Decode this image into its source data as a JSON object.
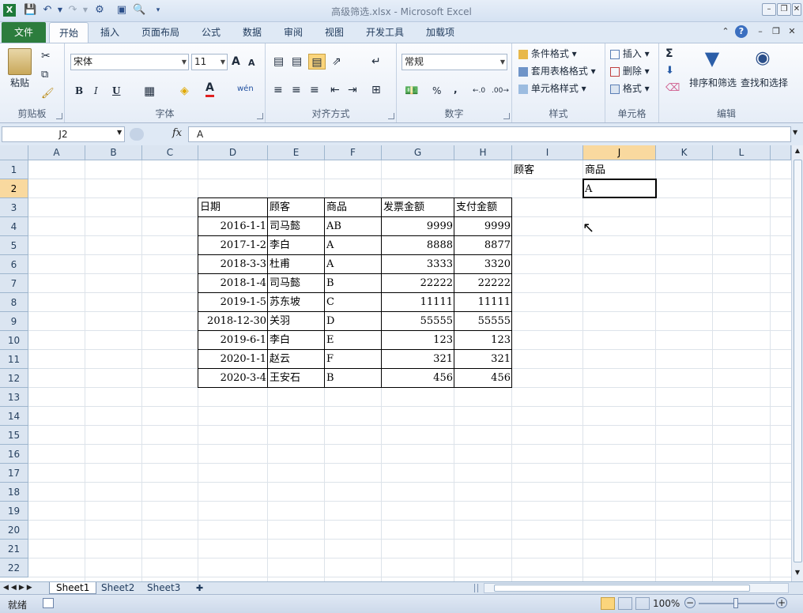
{
  "window": {
    "title": "高级筛选.xlsx - Microsoft Excel"
  },
  "ribbon_tabs": [
    "文件",
    "开始",
    "插入",
    "页面布局",
    "公式",
    "数据",
    "审阅",
    "视图",
    "开发工具",
    "加载项"
  ],
  "ribbon": {
    "clipboard": {
      "paste": "粘贴",
      "group": "剪贴板"
    },
    "font": {
      "name": "宋体",
      "size": "11",
      "bold": "B",
      "italic": "I",
      "underline": "U",
      "grow": "A",
      "shrink": "A",
      "color_a": "A",
      "wen": "wén",
      "group": "字体"
    },
    "alignment": {
      "group": "对齐方式"
    },
    "number": {
      "format": "常规",
      "percent": "%",
      "comma": ",",
      "group": "数字"
    },
    "styles": {
      "conditional": "条件格式",
      "table": "套用表格格式",
      "cell": "单元格样式",
      "group": "样式"
    },
    "cells": {
      "insert": "插入",
      "delete": "删除",
      "format": "格式",
      "group": "单元格"
    },
    "editing": {
      "sigma": "Σ",
      "sort": "排序和筛选",
      "find": "查找和选择",
      "group": "编辑"
    }
  },
  "formula_bar": {
    "name_box": "J2",
    "fx": "fx",
    "value": "A"
  },
  "columns": [
    "A",
    "B",
    "C",
    "D",
    "E",
    "F",
    "G",
    "H",
    "I",
    "J",
    "K",
    "L"
  ],
  "rows": [
    "1",
    "2",
    "3",
    "4",
    "5",
    "6",
    "7",
    "8",
    "9",
    "10",
    "11",
    "12",
    "13",
    "14",
    "15",
    "16",
    "17",
    "18",
    "19",
    "20",
    "21",
    "22"
  ],
  "selected": {
    "column": "J",
    "row": "2"
  },
  "criteria": {
    "header_customer": "顾客",
    "header_product": "商品",
    "value_product": "A"
  },
  "table": {
    "headers": [
      "日期",
      "顾客",
      "商品",
      "发票金额",
      "支付金额"
    ],
    "rows": [
      [
        "2016-1-1",
        "司马懿",
        "AB",
        "9999",
        "9999"
      ],
      [
        "2017-1-2",
        "李白",
        "A",
        "8888",
        "8877"
      ],
      [
        "2018-3-3",
        "杜甫",
        "A",
        "3333",
        "3320"
      ],
      [
        "2018-1-4",
        "司马懿",
        "B",
        "22222",
        "22222"
      ],
      [
        "2019-1-5",
        "苏东坡",
        "C",
        "11111",
        "11111"
      ],
      [
        "2018-12-30",
        "关羽",
        "D",
        "55555",
        "55555"
      ],
      [
        "2019-6-1",
        "李白",
        "E",
        "123",
        "123"
      ],
      [
        "2020-1-1",
        "赵云",
        "F",
        "321",
        "321"
      ],
      [
        "2020-3-4",
        "王安石",
        "B",
        "456",
        "456"
      ]
    ]
  },
  "sheets": [
    "Sheet1",
    "Sheet2",
    "Sheet3"
  ],
  "active_sheet": "Sheet1",
  "status": {
    "ready": "就绪",
    "zoom": "100%"
  },
  "colors": {
    "file_tab": "#2c7d3d",
    "header_bg": "#dbe5f1",
    "selected_header": "#f9d99f"
  }
}
